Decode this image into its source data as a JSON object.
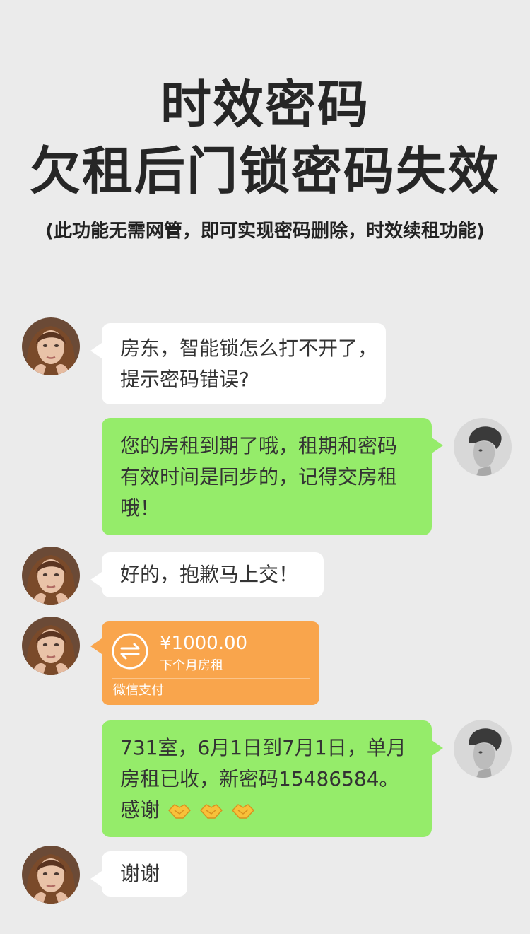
{
  "header": {
    "line1": "时效密码",
    "line2": "欠租后门锁密码失效",
    "subtitle": "(此功能无需网管，即可实现密码删除，时效续租功能)"
  },
  "chat": {
    "m1": {
      "sender": "tenant",
      "line1": "房东，智能锁怎么打不开了，",
      "line2": "提示密码错误?"
    },
    "m2": {
      "sender": "landlord",
      "line1": "您的房租到期了哦，租期和密码",
      "line2": "有效时间是同步的，记得交房租",
      "line3": "哦！"
    },
    "m3": {
      "sender": "tenant",
      "text": "好的，抱歉马上交！"
    },
    "m4": {
      "sender": "tenant",
      "amount": "¥1000.00",
      "note": "下个月房租",
      "brand": "微信支付"
    },
    "m5": {
      "sender": "landlord",
      "line1": "731室，6月1日到7月1日，单月",
      "line2": "房租已收，新密码15486584。",
      "line3": "感谢"
    },
    "m6": {
      "sender": "tenant",
      "text": "谢谢"
    }
  },
  "colors": {
    "background": "#ebebeb",
    "bubble_white": "#ffffff",
    "bubble_green": "#95ec6a",
    "payment_orange": "#f9a54c"
  },
  "icons": [
    "female-avatar",
    "male-avatar",
    "transfer-icon",
    "handshake-icon"
  ]
}
